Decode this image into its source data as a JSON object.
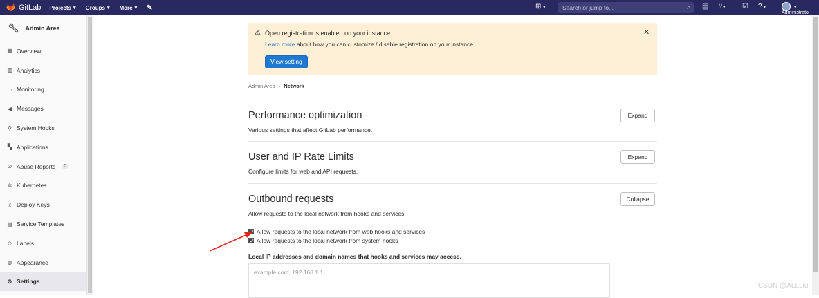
{
  "topbar": {
    "brand": "GitLab",
    "nav": [
      {
        "label": "Projects"
      },
      {
        "label": "Groups"
      },
      {
        "label": "More"
      }
    ],
    "search_placeholder": "Search or jump to...",
    "user": "Administrato"
  },
  "sidebar": {
    "title": "Admin Area",
    "items": [
      {
        "label": "Overview",
        "icon": "overview-icon"
      },
      {
        "label": "Analytics",
        "icon": "analytics-icon"
      },
      {
        "label": "Monitoring",
        "icon": "monitor-icon"
      },
      {
        "label": "Messages",
        "icon": "bullhorn-icon"
      },
      {
        "label": "System Hooks",
        "icon": "hook-icon"
      },
      {
        "label": "Applications",
        "icon": "grid-icon"
      },
      {
        "label": "Abuse Reports",
        "icon": "abuse-icon",
        "count": "0"
      },
      {
        "label": "Kubernetes",
        "icon": "kubernetes-icon"
      },
      {
        "label": "Deploy Keys",
        "icon": "key-icon"
      },
      {
        "label": "Service Templates",
        "icon": "template-icon"
      },
      {
        "label": "Labels",
        "icon": "label-icon"
      },
      {
        "label": "Appearance",
        "icon": "palette-icon"
      },
      {
        "label": "Settings",
        "icon": "settings-icon",
        "active": true
      }
    ]
  },
  "alert": {
    "title": "Open registration is enabled on your instance.",
    "link_text": "Learn more",
    "body_text": " about how you can customize / disable registration on your instance.",
    "button_label": "View setting"
  },
  "breadcrumb": {
    "root": "Admin Area",
    "current": "Network"
  },
  "sections": [
    {
      "title": "Performance optimization",
      "description": "Various settings that affect GitLab performance.",
      "button": "Expand"
    },
    {
      "title": "User and IP Rate Limits",
      "description": "Configure limits for web and API requests.",
      "button": "Expand"
    },
    {
      "title": "Outbound requests",
      "description": "Allow requests to the local network from hooks and services.",
      "button": "Collapse"
    }
  ],
  "outbound": {
    "checkbox1": {
      "label": "Allow requests to the local network from web hooks and services",
      "checked": true
    },
    "checkbox2": {
      "label": "Allow requests to the local network from system hooks",
      "checked": true
    },
    "field_label": "Local IP addresses and domain names that hooks and services may access.",
    "field_placeholder": "example.com, 192.168.1.1"
  },
  "watermark": "CSDN @ALLLiu",
  "colors": {
    "topbar": "#292961",
    "primary": "#1f78d1",
    "alert_bg": "#fdf0d7",
    "arrow": "#e3241b"
  }
}
